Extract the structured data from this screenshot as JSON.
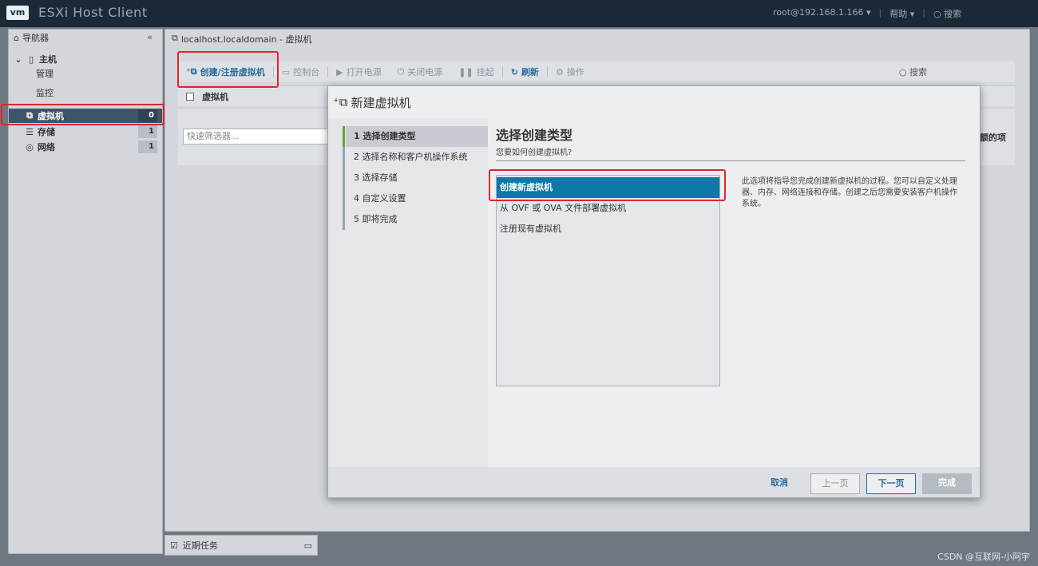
{
  "topbar": {
    "logo": "vm",
    "title": "ESXi Host Client",
    "user": "root@192.168.1.166 ▾",
    "help": "帮助 ▾",
    "search": "搜索"
  },
  "navigator": {
    "title": "导航器",
    "items": [
      {
        "label": "主机",
        "icon": "host-icon"
      },
      {
        "label": "管理"
      },
      {
        "label": "监控"
      },
      {
        "label": "虚拟机",
        "count": "0"
      },
      {
        "label": "存储",
        "count": "1"
      },
      {
        "label": "网络",
        "count": "1"
      }
    ]
  },
  "main": {
    "title": "localhost.localdomain - 虚拟机",
    "toolbar": {
      "create": "创建/注册虚拟机",
      "console": "控制台",
      "power_on": "打开电源",
      "power_off": "关闭电源",
      "suspend": "挂起",
      "refresh": "刷新",
      "actions": "操作",
      "search": "搜索"
    },
    "grid_header": "虚拟机",
    "filter_placeholder": "快速筛选器...",
    "grid_hint": "额的项"
  },
  "recent_tasks": "近期任务",
  "wizard": {
    "title": "新建虚拟机",
    "steps": [
      "1  选择创建类型",
      "2  选择名称和客户机操作系统",
      "3  选择存储",
      "4  自定义设置",
      "5  即将完成"
    ],
    "content_title": "选择创建类型",
    "content_subtitle": "您要如何创建虚拟机?",
    "options": [
      "创建新虚拟机",
      "从 OVF 或 OVA 文件部署虚拟机",
      "注册现有虚拟机"
    ],
    "description": "此选项将指导您完成创建新虚拟机的过程。您可以自定义处理器、内存、网络连接和存储。创建之后您需要安装客户机操作系统。",
    "buttons": {
      "cancel": "取消",
      "prev": "上一页",
      "next": "下一页",
      "finish": "完成"
    }
  },
  "watermark": "CSDN @互联网-小阿宇",
  "colors": {
    "highlight": "#e1262c",
    "selected": "#0f78a7",
    "active_step": "#64a43a"
  }
}
